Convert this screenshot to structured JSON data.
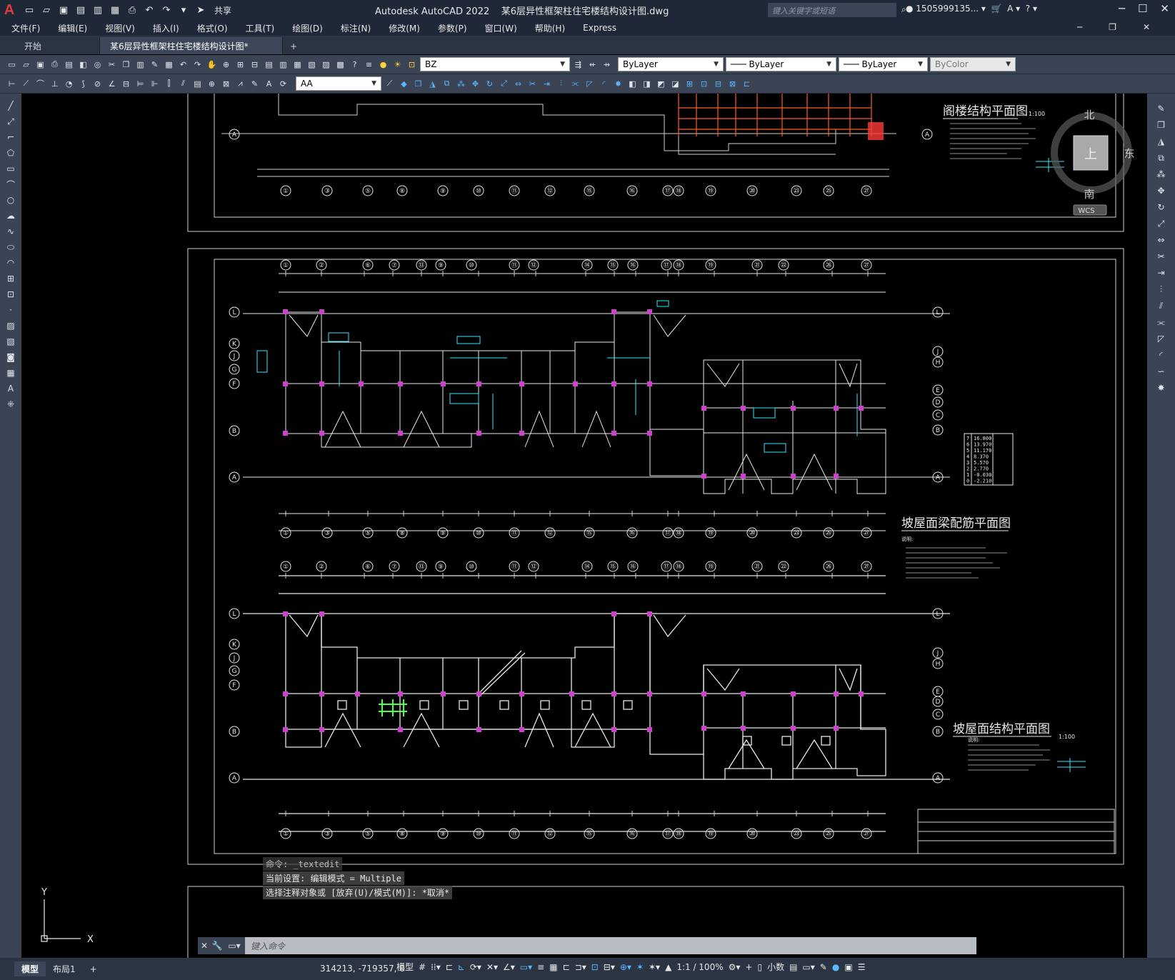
{
  "app": {
    "title": "Autodesk AutoCAD 2022",
    "document": "某6层异性框架柱住宅楼结构设计图.dwg",
    "share_label": "共享",
    "search_placeholder": "键入关键字或短语",
    "user": "1505999135...",
    "logo": "A"
  },
  "menu": [
    "文件(F)",
    "编辑(E)",
    "视图(V)",
    "插入(I)",
    "格式(O)",
    "工具(T)",
    "绘图(D)",
    "标注(N)",
    "修改(M)",
    "参数(P)",
    "窗口(W)",
    "帮助(H)",
    "Express"
  ],
  "tabs": {
    "start": "开始",
    "active": "某6层异性框架柱住宅楼结构设计图*",
    "add": "+"
  },
  "toolbar": {
    "layer_name": "BZ",
    "color": "ByLayer",
    "linetype": "ByLayer",
    "lineweight": "ByLayer",
    "plotstyle": "ByColor",
    "textstyle": "AA"
  },
  "drawing": {
    "title_attic": "阁楼结构平面图",
    "title_roof_beam": "坡屋面梁配筋平面图",
    "title_roof_struct": "坡屋面结构平面图",
    "scale_1": "1:100",
    "scale_2": "1:100",
    "notes_label": "说明:",
    "grid_top": [
      "①",
      "②",
      "⑥",
      "⑦",
      "⑬",
      "⑨",
      "⑩",
      "⑪",
      "⑫",
      "⑭",
      "⑮",
      "⑯",
      "⑰",
      "⑱",
      "⑲",
      "㉑",
      "㉒",
      "㉖",
      "㉗"
    ],
    "grid_bottom": [
      "①",
      "③",
      "⑤",
      "⑧",
      "⑨",
      "⑩",
      "⑪",
      "⑫",
      "⑮",
      "⑯",
      "⑰",
      "⑱",
      "⑲",
      "⑳",
      "㉓",
      "㉕",
      "㉗"
    ],
    "grid_left": [
      "L",
      "K",
      "J",
      "G",
      "F",
      "B",
      "A"
    ],
    "grid_right": [
      "L",
      "J",
      "H",
      "E",
      "D",
      "C",
      "B",
      "A"
    ],
    "level_table": [
      [
        "7",
        "16.800"
      ],
      [
        "6",
        "13.970"
      ],
      [
        "5",
        "11.170"
      ],
      [
        "4",
        "8.370"
      ],
      [
        "3",
        "5.570"
      ],
      [
        "2",
        "2.770"
      ],
      [
        "1",
        "-0.030"
      ],
      [
        "0",
        "-2.210"
      ]
    ]
  },
  "viewcube": {
    "north": "北",
    "east": "东",
    "south": "南",
    "face": "上",
    "wcs": "WCS"
  },
  "ucs": {
    "y": "Y",
    "x": "X"
  },
  "command": {
    "history": [
      "命令: _textedit",
      "当前设置: 编辑模式 = Multiple",
      "选择注释对象或 [放弃(U)/模式(M)]: *取消*"
    ],
    "placeholder": "键入命令"
  },
  "status": {
    "tab_model": "模型",
    "tab_layout": "布局1",
    "coords": "314213, -719357, 0",
    "space": "模型",
    "scale": "1:1 / 100%",
    "units": "小数"
  }
}
